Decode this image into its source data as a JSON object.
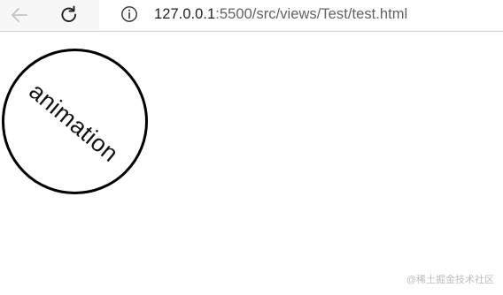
{
  "browser": {
    "url_host": "127.0.0.1",
    "url_rest": ":5500/src/views/Test/test.html",
    "icons": {
      "back": "arrow-left-icon",
      "reload": "reload-icon",
      "site_info": "info-icon"
    }
  },
  "page": {
    "circle_text": "animation"
  },
  "watermark": "@稀土掘金技术社区"
}
